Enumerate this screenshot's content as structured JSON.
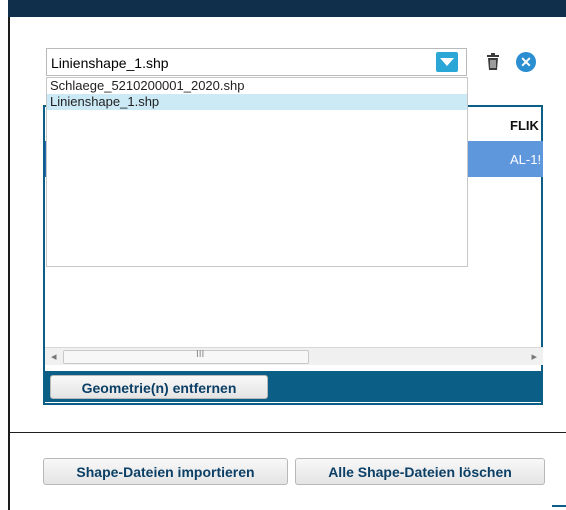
{
  "shapefile_select": {
    "selected": "Linienshape_1.shp",
    "options": [
      "Schlaege_5210200001_2020.shp",
      "Linienshape_1.shp"
    ]
  },
  "icons": {
    "trash": "trash-icon",
    "close": "close-icon",
    "dropdown": "chevron-down-icon"
  },
  "table": {
    "columns": [
      "FLIK"
    ],
    "rows": [
      {
        "flik": "AL-1!"
      }
    ]
  },
  "scrollbar": {
    "left_arrow": "◂",
    "right_arrow": "▸",
    "grip": "III"
  },
  "buttons": {
    "remove_geometry": "Geometrie(n) entfernen",
    "import_shapes": "Shape-Dateien importieren",
    "delete_all_shapes": "Alle Shape-Dateien löschen"
  },
  "colors": {
    "accent": "#0b5f86",
    "select_arrow": "#2aa7d6",
    "row_highlight": "#5f97dd",
    "option_highlight": "#cceaf6"
  }
}
